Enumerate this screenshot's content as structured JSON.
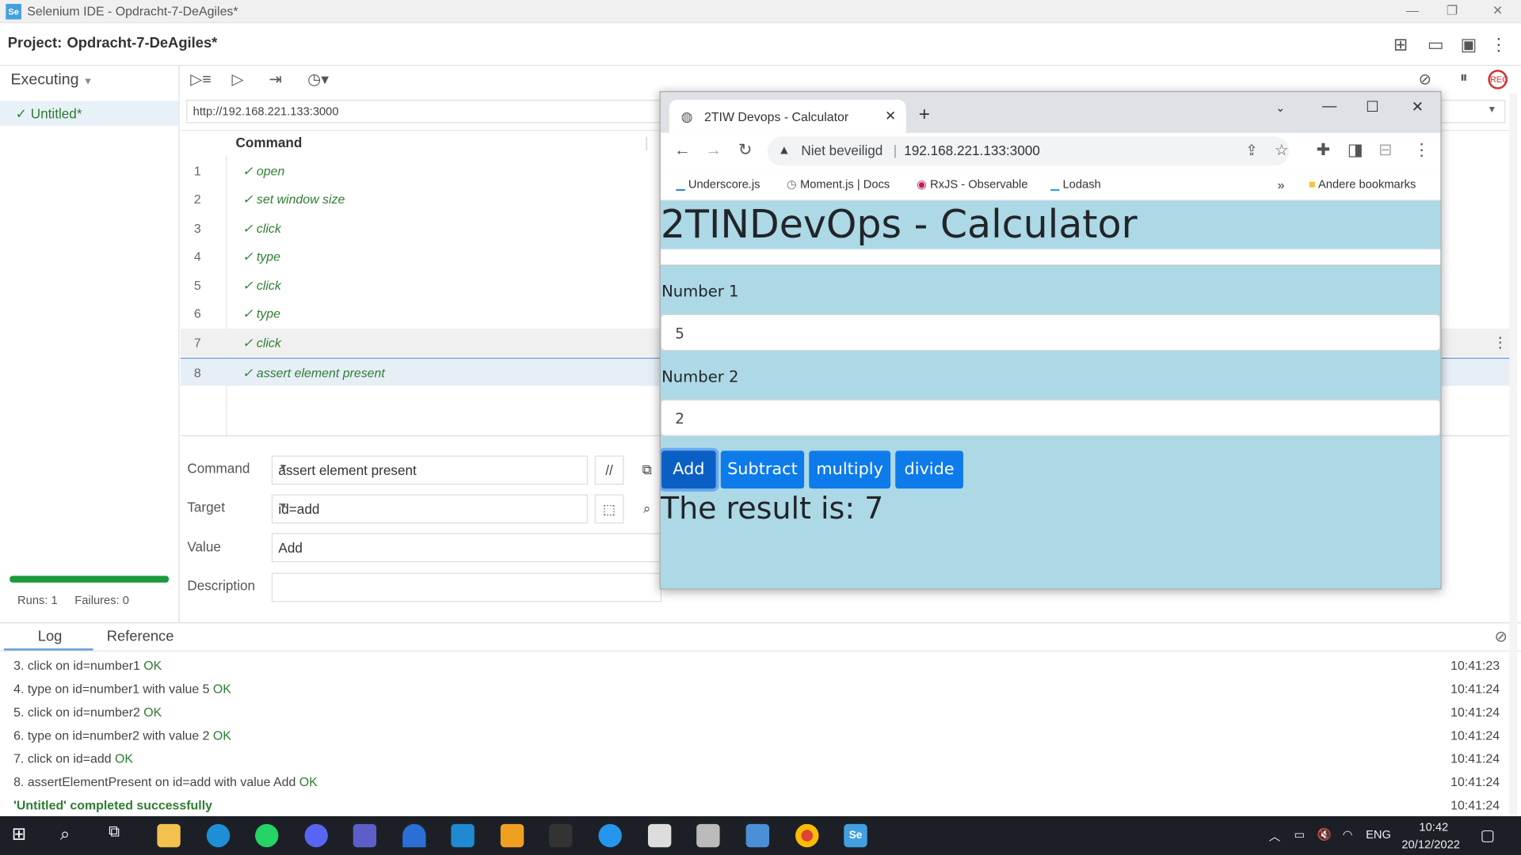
{
  "app": {
    "window_title": "Selenium IDE - Opdracht-7-DeAgiles*",
    "logo": "Se",
    "project_label": "Project:",
    "project_name": "Opdracht-7-DeAgiles*"
  },
  "left": {
    "executing_label": "Executing",
    "test_name": "✓ Untitled*",
    "runs": "Runs: 1",
    "failures": "Failures: 0"
  },
  "editor": {
    "base_url": "http://192.168.221.133:3000",
    "column_header": "Command",
    "rows": [
      {
        "num": "1",
        "command": "✓ open"
      },
      {
        "num": "2",
        "command": "✓ set window size"
      },
      {
        "num": "3",
        "command": "✓ click"
      },
      {
        "num": "4",
        "command": "✓ type"
      },
      {
        "num": "5",
        "command": "✓ click"
      },
      {
        "num": "6",
        "command": "✓ type"
      },
      {
        "num": "7",
        "command": "✓ click"
      },
      {
        "num": "8",
        "command": "✓ assert element present"
      }
    ],
    "command_label": "Command",
    "command_value": "assert element present",
    "comment_button": "//",
    "target_label": "Target",
    "target_value": "id=add",
    "value_label": "Value",
    "value_value": "Add",
    "description_label": "Description",
    "description_value": ""
  },
  "log": {
    "tab_log": "Log",
    "tab_reference": "Reference",
    "lines": [
      {
        "text": "3.  click on id=number1 ",
        "status": "OK",
        "time": "10:41:23"
      },
      {
        "text": "4.  type on id=number1 with value 5 ",
        "status": "OK",
        "time": "10:41:24"
      },
      {
        "text": "5.  click on id=number2 ",
        "status": "OK",
        "time": "10:41:24"
      },
      {
        "text": "6.  type on id=number2 with value 2 ",
        "status": "OK",
        "time": "10:41:24"
      },
      {
        "text": "7.  click on id=add ",
        "status": "OK",
        "time": "10:41:24"
      },
      {
        "text": "8.  assertElementPresent on id=add with value Add ",
        "status": "OK",
        "time": "10:41:24"
      }
    ],
    "completed": "'Untitled' completed successfully",
    "completed_time": "10:41:24"
  },
  "browser": {
    "tab_title": "2TIW Devops - Calculator",
    "security": "Niet beveiligd",
    "url": "192.168.221.133:3000",
    "bookmarks": [
      "Underscore.js",
      "Moment.js | Docs",
      "RxJS - Observable",
      "Lodash"
    ],
    "more_bookmarks": "»",
    "other_bookmarks": "Andere bookmarks"
  },
  "page": {
    "heading": "2TINDevOps - Calculator",
    "number1_label": "Number 1",
    "number1_value": "5",
    "number2_label": "Number 2",
    "number2_value": "2",
    "buttons": [
      "Add",
      "Subtract",
      "multiply",
      "divide"
    ],
    "result": "The result is: 7"
  },
  "taskbar": {
    "lang": "ENG",
    "time": "10:42",
    "date": "20/12/2022"
  },
  "colors": {
    "page_bg": "#add8e6",
    "button_blue": "#0d7bea",
    "ok_green": "#2e7d32",
    "progress_green": "#1a9a3c"
  }
}
